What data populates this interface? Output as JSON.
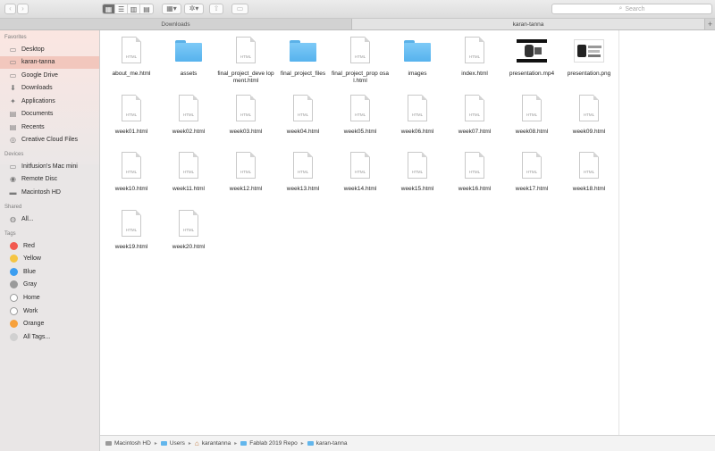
{
  "toolbar": {
    "back_glyph": "‹",
    "forward_glyph": "›",
    "view_modes": [
      "▦",
      "☰",
      "▥",
      "▤"
    ],
    "group_glyph": "▦▾",
    "action_glyph": "✲▾",
    "share_glyph": "⇧",
    "tag_glyph": "▭",
    "search_placeholder": "Search",
    "search_glyph": "⌕"
  },
  "tabs": [
    {
      "label": "Downloads"
    },
    {
      "label": "karan-tanna"
    }
  ],
  "tab_add": "+",
  "sidebar": {
    "sections": [
      {
        "title": "Favorites"
      },
      {
        "title": "Devices"
      },
      {
        "title": "Shared"
      },
      {
        "title": "Tags"
      }
    ],
    "favorites": [
      {
        "label": "Desktop",
        "icon": "desktop-icon"
      },
      {
        "label": "karan-tanna",
        "icon": "folder-icon"
      },
      {
        "label": "Google Drive",
        "icon": "drive-icon"
      },
      {
        "label": "Downloads",
        "icon": "downloads-icon"
      },
      {
        "label": "Applications",
        "icon": "applications-icon"
      },
      {
        "label": "Documents",
        "icon": "documents-icon"
      },
      {
        "label": "Recents",
        "icon": "recents-icon"
      },
      {
        "label": "Creative Cloud Files",
        "icon": "creative-cloud-icon"
      }
    ],
    "devices": [
      {
        "label": "Initfusion's Mac mini",
        "icon": "computer-icon"
      },
      {
        "label": "Remote Disc",
        "icon": "disc-icon"
      },
      {
        "label": "Macintosh HD",
        "icon": "harddisk-icon"
      }
    ],
    "shared": [
      {
        "label": "All...",
        "icon": "network-icon"
      }
    ],
    "tags": [
      {
        "label": "Red",
        "color": "#f25a50"
      },
      {
        "label": "Yellow",
        "color": "#f5c543"
      },
      {
        "label": "Blue",
        "color": "#3c9ef0"
      },
      {
        "label": "Gray",
        "color": "#9a9a9a"
      },
      {
        "label": "Home",
        "color": "#ffffff"
      },
      {
        "label": "Work",
        "color": "#ffffff"
      },
      {
        "label": "Orange",
        "color": "#f7a13b"
      },
      {
        "label": "All Tags...",
        "color": "#d0d0d0"
      }
    ]
  },
  "files": [
    {
      "name": "about_me.html",
      "kind": "html"
    },
    {
      "name": "assets",
      "kind": "folder"
    },
    {
      "name": "final_project_deve lopment.html",
      "kind": "html"
    },
    {
      "name": "final_project_files",
      "kind": "folder"
    },
    {
      "name": "final_project_prop osal.html",
      "kind": "html"
    },
    {
      "name": "images",
      "kind": "folder"
    },
    {
      "name": "index.html",
      "kind": "html"
    },
    {
      "name": "presentation.mp4",
      "kind": "video"
    },
    {
      "name": "presentation.png",
      "kind": "image"
    },
    {
      "name": "week01.html",
      "kind": "html"
    },
    {
      "name": "week02.html",
      "kind": "html"
    },
    {
      "name": "week03.html",
      "kind": "html"
    },
    {
      "name": "week04.html",
      "kind": "html"
    },
    {
      "name": "week05.html",
      "kind": "html"
    },
    {
      "name": "week06.html",
      "kind": "html"
    },
    {
      "name": "week07.html",
      "kind": "html"
    },
    {
      "name": "week08.html",
      "kind": "html"
    },
    {
      "name": "week09.html",
      "kind": "html"
    },
    {
      "name": "week10.html",
      "kind": "html"
    },
    {
      "name": "week11.html",
      "kind": "html"
    },
    {
      "name": "week12.html",
      "kind": "html"
    },
    {
      "name": "week13.html",
      "kind": "html"
    },
    {
      "name": "week14.html",
      "kind": "html"
    },
    {
      "name": "week15.html",
      "kind": "html"
    },
    {
      "name": "week16.html",
      "kind": "html"
    },
    {
      "name": "week17.html",
      "kind": "html"
    },
    {
      "name": "week18.html",
      "kind": "html"
    },
    {
      "name": "week19.html",
      "kind": "html"
    },
    {
      "name": "week20.html",
      "kind": "html"
    }
  ],
  "html_badge": "HTML",
  "pathbar": [
    {
      "label": "Macintosh HD",
      "icon": "harddisk-icon"
    },
    {
      "label": "Users",
      "icon": "folder-icon"
    },
    {
      "label": "karantanna",
      "icon": "home-icon"
    },
    {
      "label": "Fablab 2019 Repo",
      "icon": "folder-icon"
    },
    {
      "label": "karan-tanna",
      "icon": "folder-icon"
    }
  ],
  "path_separator": "▸"
}
